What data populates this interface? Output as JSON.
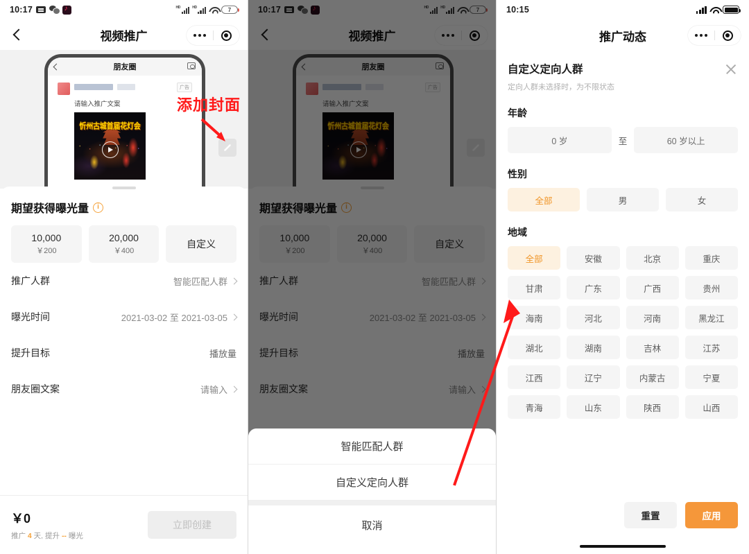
{
  "panel1": {
    "status": {
      "time": "10:17",
      "battery": "7",
      "icons": [
        "sms-icon",
        "wechat-icon",
        "tiktok-icon",
        "signal-hd-icon",
        "signal-hd-icon",
        "wifi-icon",
        "battery-icon"
      ]
    },
    "nav": {
      "title": "视频推广",
      "back": "back-icon",
      "more": "more-icon",
      "target": "target-icon"
    },
    "preview": {
      "inner_title": "朋友圈",
      "copy_placeholder": "请输入推广文案",
      "ad_tag": "广告",
      "thumb_title": "忻州古城首届花灯会"
    },
    "annotation": {
      "text": "添加封面"
    },
    "section_title": "期望获得曝光量",
    "exposure": [
      {
        "amount": "10,000",
        "price": "￥200"
      },
      {
        "amount": "20,000",
        "price": "￥400"
      },
      {
        "amount": "自定义",
        "price": ""
      }
    ],
    "rows": [
      {
        "label": "推广人群",
        "value": "智能匹配人群",
        "chevron": true
      },
      {
        "label": "曝光时间",
        "value": "2021-03-02 至 2021-03-05",
        "chevron": true
      },
      {
        "label": "提升目标",
        "value": "播放量",
        "chevron": false
      },
      {
        "label": "朋友圈文案",
        "value": "请输入",
        "chevron": true
      }
    ],
    "bottom": {
      "price": "￥0",
      "sub_prefix": "推广 ",
      "sub_days": "4",
      "sub_mid": " 天, 提升 ",
      "sub_exposure": "--",
      "sub_suffix": " 曝光",
      "cta": "立即创建"
    }
  },
  "panel2": {
    "action_sheet": {
      "items": [
        "智能匹配人群",
        "自定义定向人群"
      ],
      "cancel": "取消"
    }
  },
  "panel3": {
    "status": {
      "time": "10:15",
      "icons": [
        "signal-icon",
        "wifi-icon",
        "battery-icon"
      ]
    },
    "nav": {
      "title": "推广动态",
      "more": "more-icon",
      "target": "target-icon"
    },
    "header": {
      "title": "自定义定向人群",
      "subtitle": "定向人群未选择时，为不限状态",
      "close": "close-icon"
    },
    "age": {
      "label": "年龄",
      "from": "0 岁",
      "sep": "至",
      "to": "60 岁以上"
    },
    "gender": {
      "label": "性别",
      "options": [
        "全部",
        "男",
        "女"
      ],
      "selected": 0
    },
    "region": {
      "label": "地域",
      "options": [
        "全部",
        "安徽",
        "北京",
        "重庆",
        "甘肃",
        "广东",
        "广西",
        "贵州",
        "海南",
        "河北",
        "河南",
        "黑龙江",
        "湖北",
        "湖南",
        "吉林",
        "江苏",
        "江西",
        "辽宁",
        "内蒙古",
        "宁夏",
        "青海",
        "山东",
        "陕西",
        "山西"
      ],
      "selected": 0
    },
    "footer": {
      "reset": "重置",
      "apply": "应用"
    }
  },
  "colors": {
    "accent": "#f5973a",
    "accent_soft": "#fdf1e0",
    "annotation_red": "#ff1a1a",
    "chip_bg": "#f5f5f5",
    "text_primary": "#1a1a1a",
    "text_secondary": "#8a8a8a"
  }
}
